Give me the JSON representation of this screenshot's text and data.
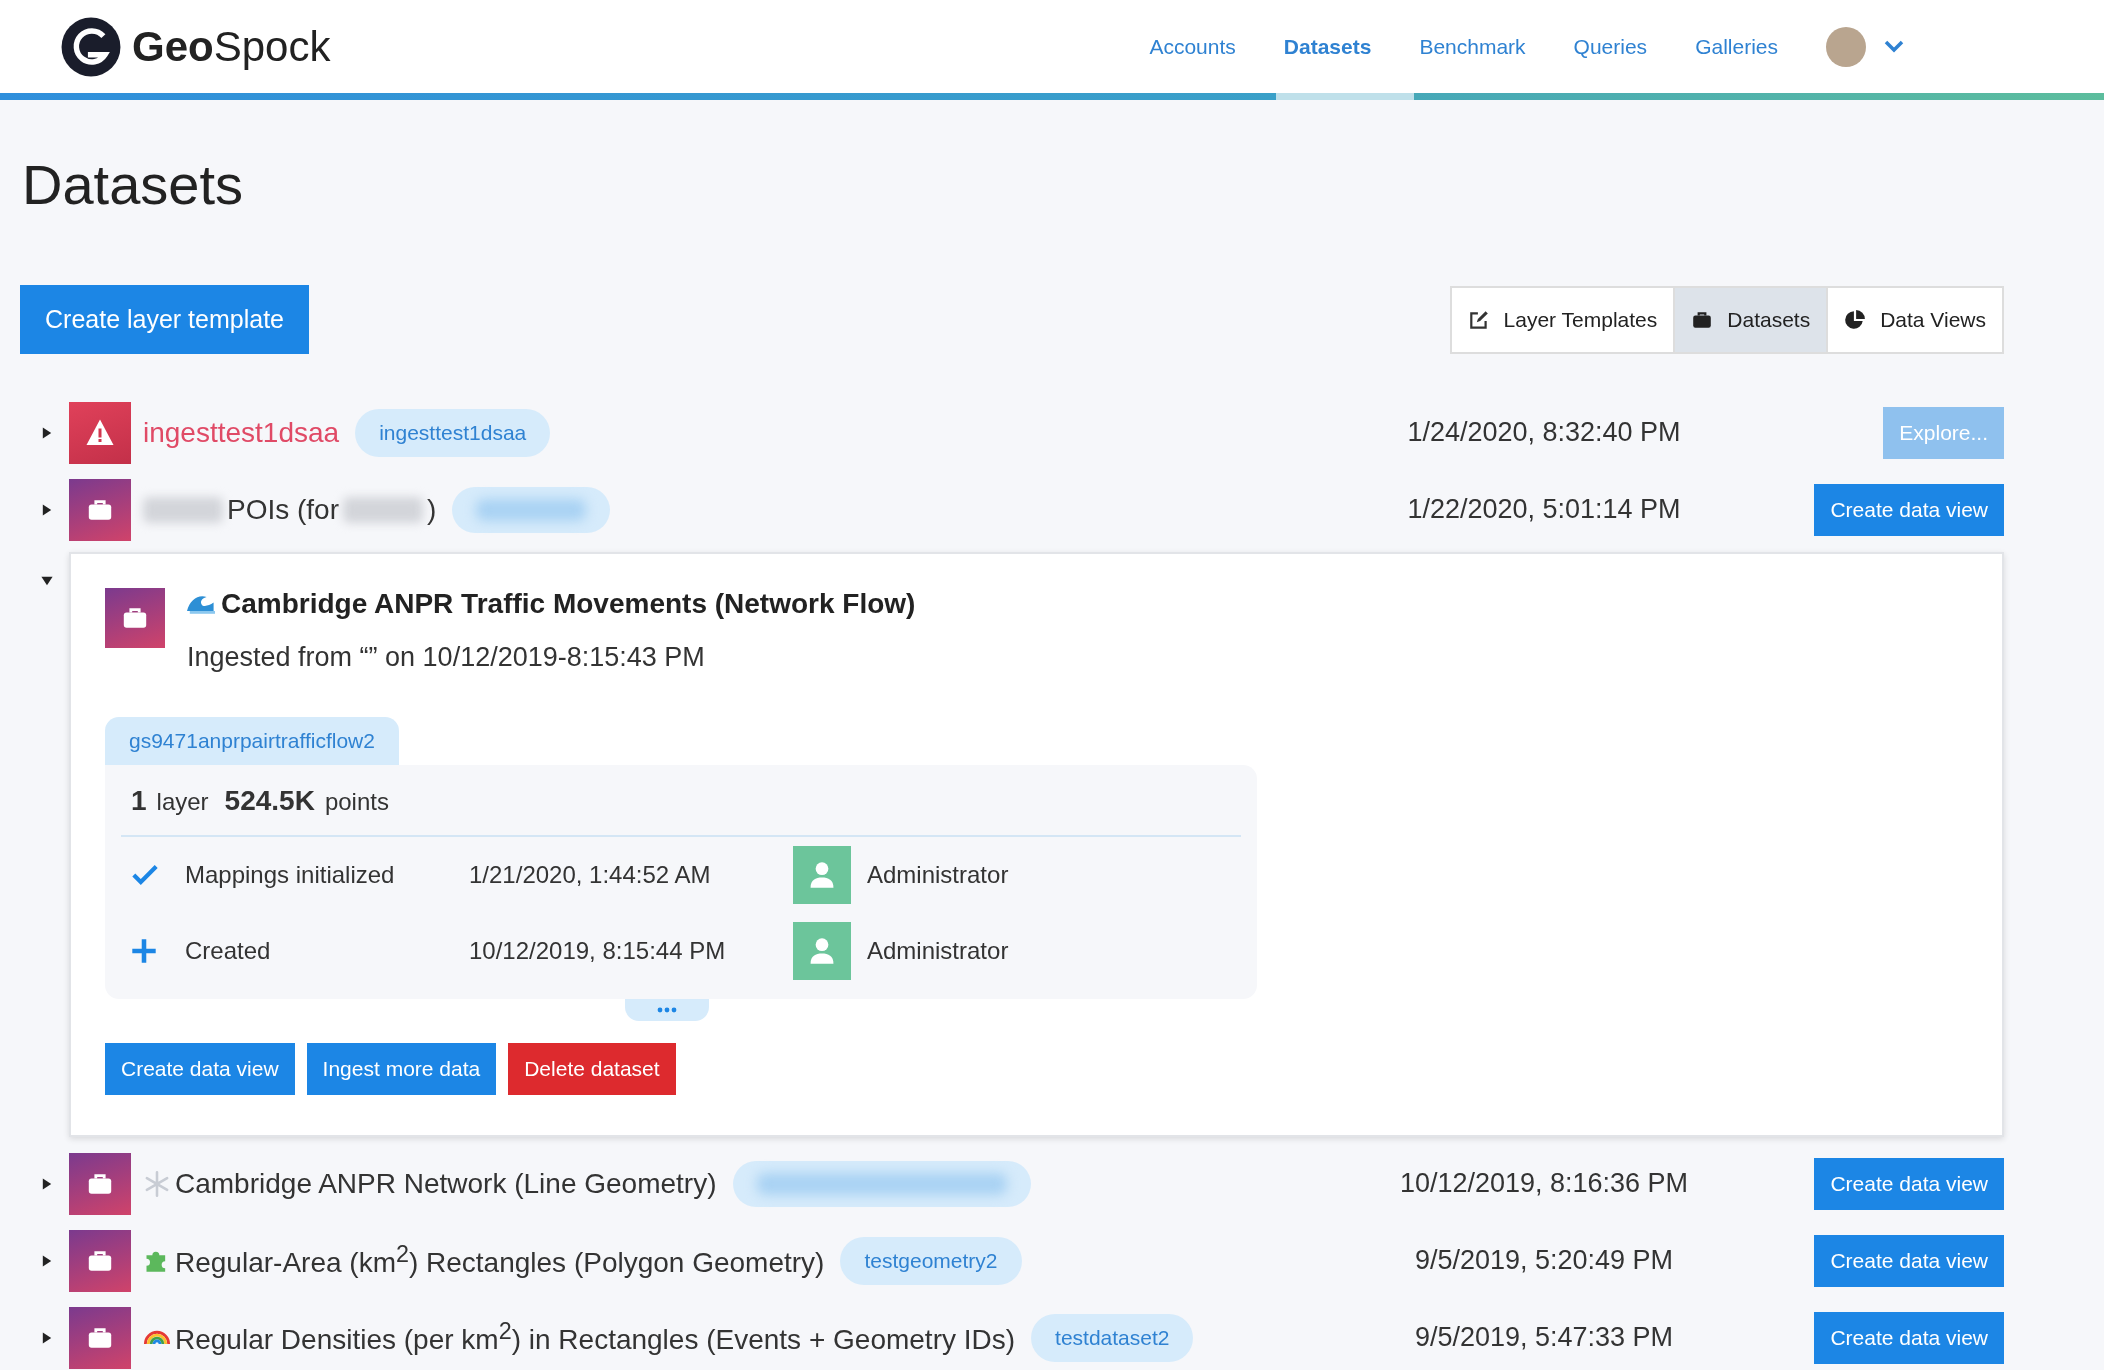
{
  "header": {
    "brand_bold": "Geo",
    "brand_light": "Spock",
    "nav": [
      {
        "label": "Accounts",
        "selected": false
      },
      {
        "label": "Datasets",
        "selected": true
      },
      {
        "label": "Benchmark",
        "selected": false
      },
      {
        "label": "Queries",
        "selected": false
      },
      {
        "label": "Galleries",
        "selected": false
      }
    ]
  },
  "page_title": "Datasets",
  "create_button": "Create layer template",
  "view_switch": [
    {
      "label": "Layer Templates",
      "selected": false
    },
    {
      "label": "Datasets",
      "selected": true
    },
    {
      "label": "Data Views",
      "selected": false
    }
  ],
  "rows": [
    {
      "kind": "error",
      "expanded": false,
      "name": [
        {
          "kind": "text",
          "text": "ingesttest1dsaa"
        }
      ],
      "tag": {
        "redacted": false,
        "text": "ingesttest1dsaa"
      },
      "date": "1/24/2020, 8:32:40 PM",
      "action": {
        "label": "Explore...",
        "disabled": true
      }
    },
    {
      "kind": "dataset",
      "expanded": false,
      "name": [
        {
          "kind": "redacted"
        },
        {
          "kind": "text",
          "text": "POIs (for"
        },
        {
          "kind": "redacted"
        },
        {
          "kind": "text",
          "text": ")"
        }
      ],
      "tag": {
        "redacted": true
      },
      "date": "1/22/2020, 5:01:14 PM",
      "action": {
        "label": "Create data view",
        "disabled": false
      }
    },
    {
      "kind": "dataset",
      "expanded": true,
      "name": [
        {
          "kind": "text",
          "text": "Cambridge ANPR Traffic Movements (Network Flow)"
        }
      ],
      "details": {
        "ingested": "Ingested from “” on 10/12/2019-8:15:43 PM",
        "tag": "gs9471anprpairtrafficflow2",
        "layer_count": "1",
        "layer_word": "layer",
        "points": "524.5K",
        "points_word": "points",
        "events": [
          {
            "kind": "check",
            "label": "Mappings initialized",
            "time": "1/21/2020, 1:44:52 AM",
            "user": "Administrator"
          },
          {
            "kind": "plus",
            "label": "Created",
            "time": "10/12/2019, 8:15:44 PM",
            "user": "Administrator"
          }
        ],
        "buttons": [
          {
            "label": "Create data view",
            "kind": "primary"
          },
          {
            "label": "Ingest more data",
            "kind": "primary"
          },
          {
            "label": "Delete dataset",
            "kind": "danger"
          }
        ]
      }
    },
    {
      "kind": "dataset",
      "expanded": false,
      "name": [
        {
          "kind": "text",
          "text": "Cambridge ANPR Network (Line Geometry)"
        }
      ],
      "tag": {
        "redacted": true
      },
      "date": "10/12/2019, 8:16:36 PM",
      "action": {
        "label": "Create data view",
        "disabled": false
      }
    },
    {
      "kind": "dataset",
      "expanded": false,
      "name": [
        {
          "kind": "text",
          "text": "Regular-Area (km$^{2}$) Rectangles (Polygon Geometry)"
        }
      ],
      "tag": {
        "redacted": false,
        "text": "testgeometry2"
      },
      "date": "9/5/2019, 5:20:49 PM",
      "action": {
        "label": "Create data view",
        "disabled": false
      }
    },
    {
      "kind": "dataset",
      "expanded": false,
      "name": [
        {
          "kind": "text",
          "text": "Regular Densities (per km$^{2}$) in Rectangles (Events + Geometry IDs)"
        }
      ],
      "tag": {
        "redacted": false,
        "text": "testdataset2"
      },
      "date": "9/5/2019, 5:47:33 PM",
      "action": {
        "label": "Create data view",
        "disabled": false
      }
    }
  ]
}
